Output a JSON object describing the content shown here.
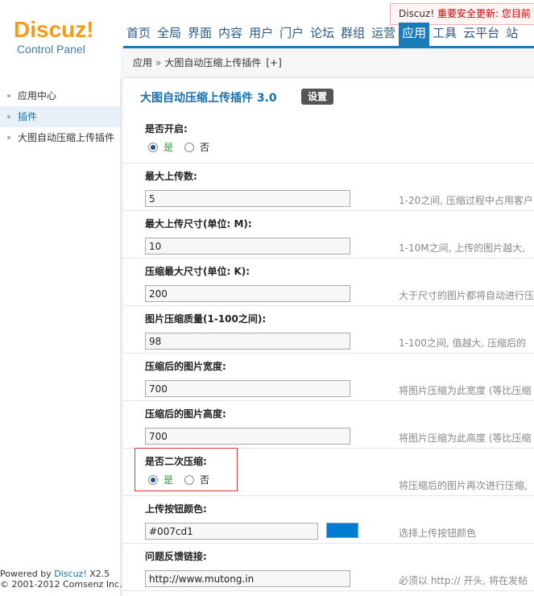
{
  "logo": {
    "brand": "Discuz",
    "bang": "!",
    "subtitle": "Control Panel"
  },
  "notice": {
    "prefix": "Discuz!",
    "text": " 重要安全更新: 您目前"
  },
  "nav": [
    {
      "label": "首页",
      "active": false
    },
    {
      "label": "全局",
      "active": false
    },
    {
      "label": "界面",
      "active": false
    },
    {
      "label": "内容",
      "active": false
    },
    {
      "label": "用户",
      "active": false
    },
    {
      "label": "门户",
      "active": false
    },
    {
      "label": "论坛",
      "active": false
    },
    {
      "label": "群组",
      "active": false
    },
    {
      "label": "运营",
      "active": false
    },
    {
      "label": "应用",
      "active": true
    },
    {
      "label": "工具",
      "active": false
    },
    {
      "label": "云平台",
      "active": false
    },
    {
      "label": "站",
      "active": false
    }
  ],
  "breadcrumb": {
    "root": "应用",
    "sep": "»",
    "current": "大图自动压缩上传插件",
    "add": "[+]"
  },
  "sidebar": {
    "items": [
      {
        "label": "应用中心",
        "active": false
      },
      {
        "label": "插件",
        "active": true
      },
      {
        "label": "大图自动压缩上传插件",
        "active": false
      }
    ],
    "powered_prefix": "Powered by ",
    "powered_brand": "Discuz!",
    "powered_version": " X2.5",
    "copyright": "© 2001-2012 Comsenz Inc."
  },
  "plugin": {
    "title": "大图自动压缩上传插件 3.0",
    "settings_label": "设置"
  },
  "form": {
    "enable": {
      "label": "是否开启:",
      "yes": "是",
      "no": "否",
      "selected": "yes"
    },
    "max_upload": {
      "label": "最大上传数:",
      "value": "5",
      "hint": "1-20之间, 压缩过程中占用客户"
    },
    "max_size": {
      "label": "最大上传尺寸(单位: M):",
      "value": "10",
      "hint": "1-10M之间, 上传的图片越大,"
    },
    "max_compress": {
      "label": "压缩最大尺寸(单位: K):",
      "value": "200",
      "hint": "大于尺寸的图片都将自动进行压"
    },
    "quality": {
      "label": "图片压缩质量(1-100之间):",
      "value": "98",
      "hint": "1-100之间, 值越大, 压缩后的"
    },
    "width": {
      "label": "压缩后的图片宽度:",
      "value": "700",
      "hint": "将图片压缩为此宽度 (等比压缩"
    },
    "height": {
      "label": "压缩后的图片高度:",
      "value": "700",
      "hint": "将图片压缩为此高度 (等比压缩"
    },
    "second": {
      "label": "是否二次压缩:",
      "yes": "是",
      "no": "否",
      "selected": "yes",
      "hint": "将压缩后的图片再次进行压缩,"
    },
    "button_color": {
      "label": "上传按钮颜色:",
      "value": "#007cd1",
      "hint": "选择上传按钮颜色",
      "swatch": "#007cd1"
    },
    "feedback": {
      "label": "问题反馈链接:",
      "value": "http://www.mutong.in",
      "hint": "必须以 http:// 开头, 将在发帖"
    }
  }
}
